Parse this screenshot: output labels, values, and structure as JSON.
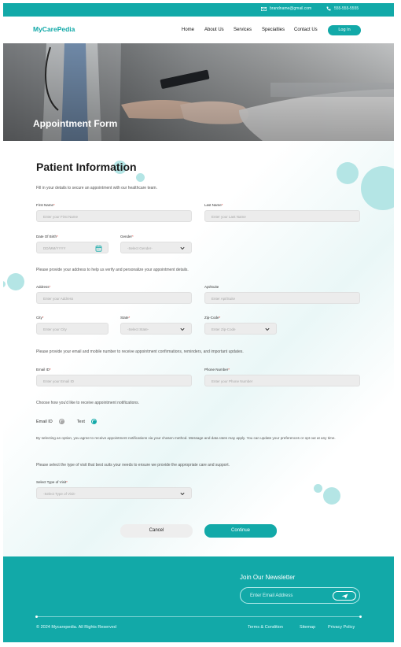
{
  "topbar": {
    "email": "brandname@gmail.com",
    "phone": "555-555-5555"
  },
  "nav": {
    "logo": "MyCarePedia",
    "items": [
      "Home",
      "About Us",
      "Services",
      "Specialties",
      "Contact Us"
    ],
    "login": "Log In"
  },
  "hero": {
    "title": "Appointment Form"
  },
  "form": {
    "title": "Patient Information",
    "intro": "Fill in your details to secure an appointment with our healthcare team.",
    "first_name": {
      "label": "First Name",
      "placeholder": "Enter your First Name"
    },
    "last_name": {
      "label": "Last Name",
      "placeholder": "Enter your Last Name"
    },
    "dob": {
      "label": "Date Of Birth",
      "placeholder": "DD/MM/YYYY"
    },
    "gender": {
      "label": "Gender",
      "placeholder": "-Select Gender-"
    },
    "address_note": "Please provide your address to help us verify and personalize your appointment details.",
    "address": {
      "label": "Address",
      "placeholder": "Enter your Address"
    },
    "apt": {
      "label": "Apt/Suite",
      "placeholder": "Enter Apt/Suite"
    },
    "city": {
      "label": "City",
      "placeholder": "Enter your City"
    },
    "state": {
      "label": "State",
      "placeholder": "-Select State-"
    },
    "zip": {
      "label": "Zip-Code",
      "placeholder": "Enter Zip-Code"
    },
    "contact_note": "Please provide your email and mobile number to receive appointment confirmations, reminders, and important updates.",
    "email": {
      "label": "Email ID",
      "placeholder": "Enter your Email ID"
    },
    "phone": {
      "label": "Phone Number",
      "placeholder": "Enter your Phone Number"
    },
    "notify_note": "Choose how you'd like to receive appointment notifications.",
    "notify_options": [
      "Email ID",
      "Text"
    ],
    "notify_selected": "Text",
    "consent": "By selecting an option, you agree to receive appointment notifications via your chosen method. Message and data rates may apply. You can update your preferences or opt out at any time.",
    "visit_note": "Please select the type of visit that best suits your needs to ensure we provide the appropriate care and support.",
    "visit": {
      "label": "Select Type of Visit",
      "placeholder": "-Select Type of Visit-"
    },
    "required_mark": "*",
    "cancel": "Cancel",
    "continue": "Continue"
  },
  "footer": {
    "newsletter_title": "Join Our Newsletter",
    "newsletter_placeholder": "Enter Email Address",
    "copyright": "© 2024 Mycarepedia. All Rights Reserved",
    "links": [
      "Terms & Condition",
      "Sitemap",
      "Privacy Policy"
    ]
  },
  "colors": {
    "accent": "#12a9a8",
    "circle": "#b4e5e5",
    "field": "#ececec"
  },
  "icons": [
    "mail-icon",
    "phone-icon",
    "calendar-icon",
    "chevron-down-icon",
    "send-icon"
  ]
}
